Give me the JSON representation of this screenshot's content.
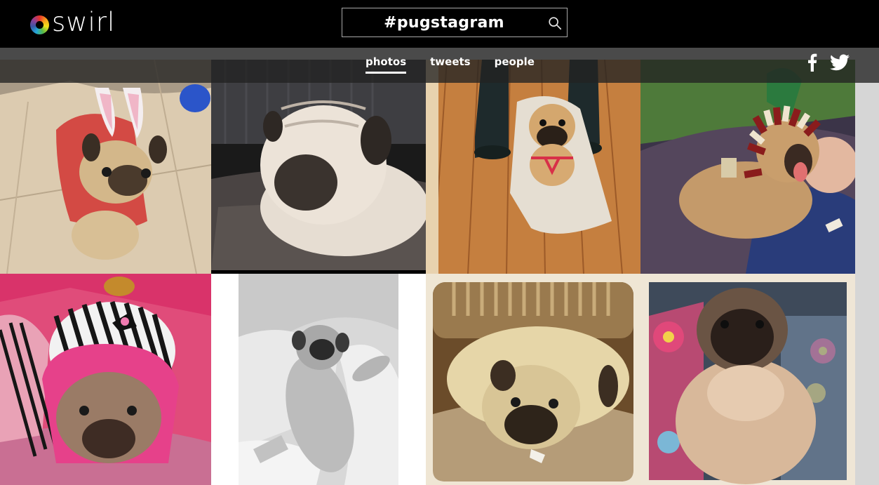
{
  "header": {
    "logo_text": "swirl",
    "search_value": "#pugstagram"
  },
  "nav": {
    "tabs": [
      {
        "label": "photos",
        "active": true
      },
      {
        "label": "tweets",
        "active": false
      },
      {
        "label": "people",
        "active": false
      }
    ]
  },
  "social": {
    "icons": [
      "facebook-icon",
      "twitter-icon"
    ]
  },
  "photos": [
    {
      "subject": "pug in bunny ears on tile floor"
    },
    {
      "subject": "wrinkly pug lying on couch cushion"
    },
    {
      "subject": "pug in blanket wrap on wood floor"
    },
    {
      "subject": "pug in costume yawning on couch"
    },
    {
      "subject": "pug in striped pink hoodie"
    },
    {
      "subject": "black and white pug on pillows"
    },
    {
      "subject": "pug resting on cushion vintage"
    },
    {
      "subject": "pug sitting on floral blanket"
    }
  ],
  "colors": {
    "topbar": "#000000",
    "subnav": "#232323",
    "accent": "#ffffff"
  }
}
